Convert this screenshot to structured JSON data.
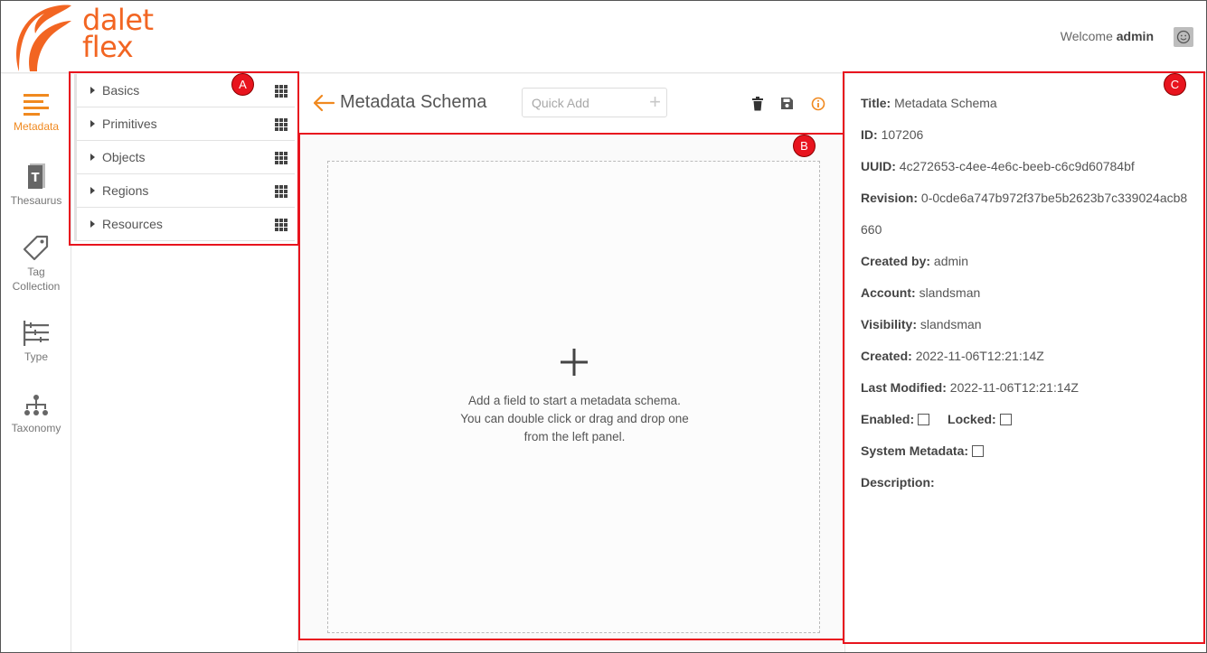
{
  "brand": {
    "logo_text_line1": "dalet",
    "logo_text_line2": "flex",
    "accent": "#f26522"
  },
  "header": {
    "welcome_prefix": "Welcome",
    "username": "admin",
    "avatar_icon": "smiley-face-icon"
  },
  "nav": {
    "items": [
      {
        "label": "Metadata",
        "icon": "lines-icon",
        "active": true
      },
      {
        "label": "Thesaurus",
        "icon": "book-icon",
        "active": false
      },
      {
        "label_line1": "Tag",
        "label_line2": "Collection",
        "icon": "tag-icon",
        "active": false
      },
      {
        "label": "Type",
        "icon": "type-hierarchy-icon",
        "active": false
      },
      {
        "label": "Taxonomy",
        "icon": "taxonomy-icon",
        "active": false
      }
    ]
  },
  "palette": {
    "items": [
      {
        "label": "Basics"
      },
      {
        "label": "Primitives"
      },
      {
        "label": "Objects"
      },
      {
        "label": "Regions"
      },
      {
        "label": "Resources"
      }
    ]
  },
  "toolbar": {
    "title": "Metadata Schema",
    "quick_add_placeholder": "Quick Add",
    "icons": [
      "trash-icon",
      "save-icon",
      "info-icon"
    ]
  },
  "dropzone": {
    "line1": "Add a field to start a metadata schema.",
    "line2": "You can double click or drag and drop one",
    "line3": "from the left panel."
  },
  "properties": {
    "title_label": "Title:",
    "title_value": "Metadata Schema",
    "id_label": "ID:",
    "id_value": "107206",
    "uuid_label": "UUID:",
    "uuid_value": "4c272653-c4ee-4e6c-beeb-c6c9d60784bf",
    "revision_label": "Revision:",
    "revision_value_line1": "0-0cde6a747b972f37be5b2623b7c339024acb8",
    "revision_value_line2": "660",
    "created_by_label": "Created by:",
    "created_by_value": "admin",
    "account_label": "Account:",
    "account_value": "slandsman",
    "visibility_label": "Visibility:",
    "visibility_value": "slandsman",
    "created_label": "Created:",
    "created_value": "2022-11-06T12:21:14Z",
    "last_modified_label": "Last Modified:",
    "last_modified_value": "2022-11-06T12:21:14Z",
    "enabled_label": "Enabled:",
    "enabled_checked": false,
    "locked_label": "Locked:",
    "locked_checked": false,
    "system_metadata_label": "System Metadata:",
    "system_metadata_checked": false,
    "description_label": "Description:"
  },
  "annotations": {
    "a": "A",
    "b": "B",
    "c": "C",
    "color": "#e8141e"
  }
}
